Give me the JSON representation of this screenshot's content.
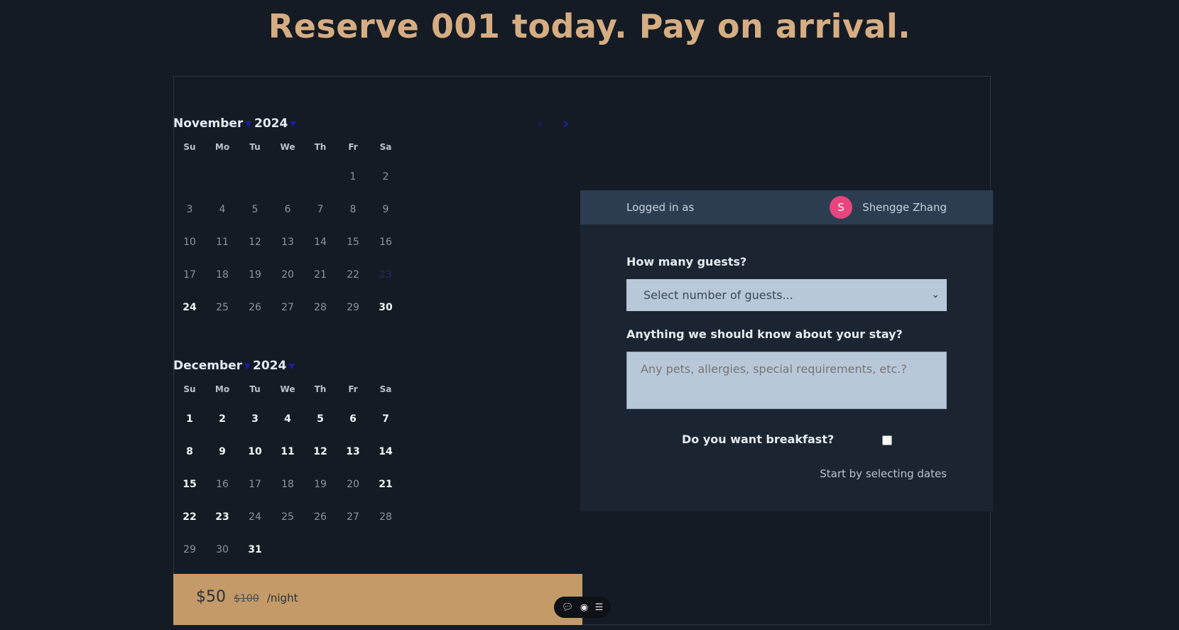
{
  "page": {
    "title": "Reserve 001 today. Pay on arrival."
  },
  "calendar": {
    "nav": {
      "prev_icon": "chevron-left-icon",
      "next_icon": "chevron-right-icon",
      "prev": "‹",
      "next": "›"
    },
    "weekdays": [
      "Su",
      "Mo",
      "Tu",
      "We",
      "Th",
      "Fr",
      "Sa"
    ],
    "months": [
      {
        "month": "November",
        "year": "2024",
        "weeks": [
          [
            {
              "d": ""
            },
            {
              "d": ""
            },
            {
              "d": ""
            },
            {
              "d": ""
            },
            {
              "d": ""
            },
            {
              "d": "1"
            },
            {
              "d": "2"
            }
          ],
          [
            {
              "d": "3"
            },
            {
              "d": "4"
            },
            {
              "d": "5"
            },
            {
              "d": "6"
            },
            {
              "d": "7"
            },
            {
              "d": "8"
            },
            {
              "d": "9"
            }
          ],
          [
            {
              "d": "10"
            },
            {
              "d": "11"
            },
            {
              "d": "12"
            },
            {
              "d": "13"
            },
            {
              "d": "14"
            },
            {
              "d": "15"
            },
            {
              "d": "16"
            }
          ],
          [
            {
              "d": "17"
            },
            {
              "d": "18"
            },
            {
              "d": "19"
            },
            {
              "d": "20"
            },
            {
              "d": "21"
            },
            {
              "d": "22"
            },
            {
              "d": "23",
              "state": "selected"
            }
          ],
          [
            {
              "d": "24",
              "state": "available"
            },
            {
              "d": "25"
            },
            {
              "d": "26"
            },
            {
              "d": "27"
            },
            {
              "d": "28"
            },
            {
              "d": "29"
            },
            {
              "d": "30",
              "state": "available"
            }
          ]
        ]
      },
      {
        "month": "December",
        "year": "2024",
        "weeks": [
          [
            {
              "d": "1",
              "state": "available"
            },
            {
              "d": "2",
              "state": "available"
            },
            {
              "d": "3",
              "state": "available"
            },
            {
              "d": "4",
              "state": "available"
            },
            {
              "d": "5",
              "state": "available"
            },
            {
              "d": "6",
              "state": "available"
            },
            {
              "d": "7",
              "state": "available"
            }
          ],
          [
            {
              "d": "8",
              "state": "available"
            },
            {
              "d": "9",
              "state": "available"
            },
            {
              "d": "10",
              "state": "available"
            },
            {
              "d": "11",
              "state": "available"
            },
            {
              "d": "12",
              "state": "available"
            },
            {
              "d": "13",
              "state": "available"
            },
            {
              "d": "14",
              "state": "available"
            }
          ],
          [
            {
              "d": "15",
              "state": "available"
            },
            {
              "d": "16"
            },
            {
              "d": "17"
            },
            {
              "d": "18"
            },
            {
              "d": "19"
            },
            {
              "d": "20"
            },
            {
              "d": "21",
              "state": "available"
            }
          ],
          [
            {
              "d": "22",
              "state": "available"
            },
            {
              "d": "23",
              "state": "available"
            },
            {
              "d": "24"
            },
            {
              "d": "25"
            },
            {
              "d": "26"
            },
            {
              "d": "27"
            },
            {
              "d": "28"
            }
          ],
          [
            {
              "d": "29"
            },
            {
              "d": "30"
            },
            {
              "d": "31",
              "state": "available"
            },
            {
              "d": ""
            },
            {
              "d": ""
            },
            {
              "d": ""
            },
            {
              "d": ""
            }
          ]
        ]
      }
    ]
  },
  "price": {
    "current": "$50",
    "original": "$100",
    "unit": "/night"
  },
  "toolbar": {
    "comment_icon": "comment-icon",
    "view_icon": "eye-icon",
    "menu_icon": "menu-icon"
  },
  "booking": {
    "logged_in_label": "Logged in as",
    "avatar_initial": "S",
    "avatar_color": "#e8457e",
    "user_name": "Shengge Zhang",
    "guests_label": "How many guests?",
    "guests_placeholder": "Select number of guests...",
    "notes_label": "Anything we should know about your stay?",
    "notes_placeholder": "Any pets, allergies, special requirements, etc.?",
    "breakfast_label": "Do you want breakfast?",
    "breakfast_checked": false,
    "hint": "Start by selecting dates"
  },
  "colors": {
    "background": "#141b24",
    "accent": "#d6ad82",
    "price_bar": "#c39a68"
  }
}
